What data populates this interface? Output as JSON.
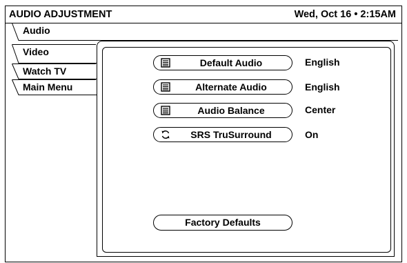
{
  "header": {
    "title": "AUDIO ADJUSTMENT",
    "datetime": "Wed, Oct 16 • 2:15AM"
  },
  "tabs": [
    {
      "label": "Audio",
      "selected": true
    },
    {
      "label": "Video",
      "selected": false
    },
    {
      "label": "Watch TV",
      "selected": false
    },
    {
      "label": "Main Menu",
      "selected": false
    }
  ],
  "settings": [
    {
      "label": "Default Audio",
      "value": "English",
      "icon": "list-icon"
    },
    {
      "label": "Alternate Audio",
      "value": "English",
      "icon": "list-icon"
    },
    {
      "label": "Audio Balance",
      "value": "Center",
      "icon": "list-icon"
    },
    {
      "label": "SRS TruSurround",
      "value": "On",
      "icon": "toggle-cycle-icon"
    }
  ],
  "factory_button": "Factory Defaults"
}
